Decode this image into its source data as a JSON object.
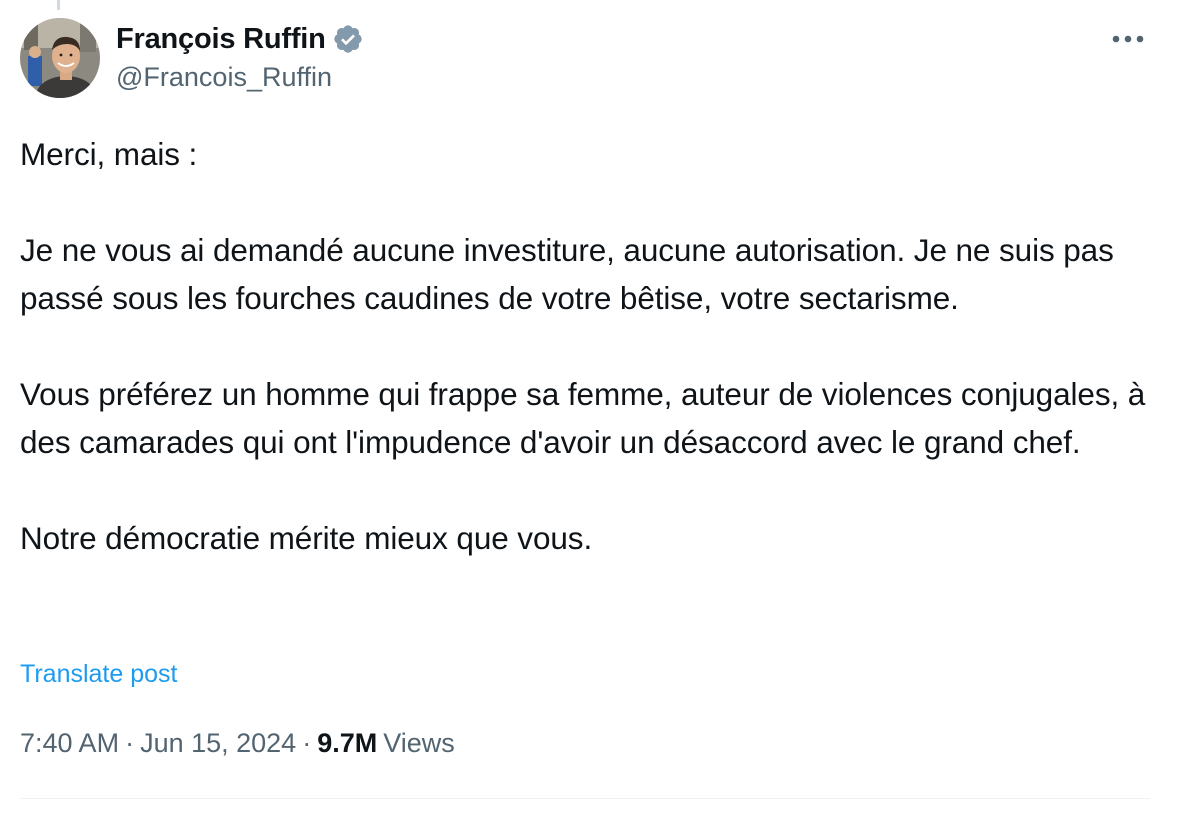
{
  "author": {
    "display_name": "François Ruffin",
    "handle": "@Francois_Ruffin",
    "verified_icon": "verified-badge-icon",
    "verified_color": "#829aab"
  },
  "post": {
    "paragraphs": [
      "Merci, mais :",
      "Je ne vous ai demandé aucune investiture, aucune autorisation. Je ne suis pas passé sous les fourches caudines de votre bêtise, votre sectarisme.",
      "Vous préférez un homme qui frappe sa femme, auteur de violences conjugales, à des camarades qui ont l'impudence d'avoir un désaccord avec le grand chef.",
      "Notre démocratie mérite mieux que vous."
    ],
    "translate_label": "Translate post"
  },
  "meta": {
    "time": "7:40 AM",
    "separator": "·",
    "date": "Jun 15, 2024",
    "views_count": "9.7M",
    "views_label": "Views"
  },
  "colors": {
    "text": "#0f1419",
    "secondary": "#536471",
    "link": "#1d9bf0",
    "divider": "#eff3f4"
  },
  "icons": {
    "more": "more-horizontal-icon"
  }
}
